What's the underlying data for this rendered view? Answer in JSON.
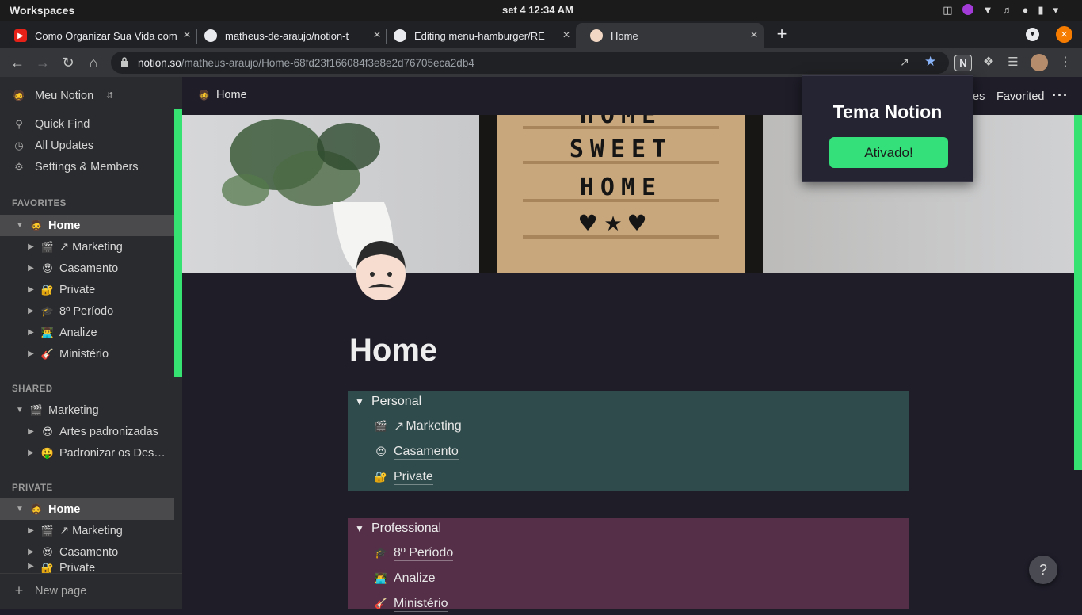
{
  "os": {
    "workspaces": "Workspaces",
    "clock": "set 4  12:34 AM"
  },
  "tabs": [
    {
      "title": "Como Organizar Sua Vida com",
      "favicon": "youtube-icon"
    },
    {
      "title": "matheus-de-araujo/notion-t",
      "favicon": "github-icon"
    },
    {
      "title": "Editing menu-hamburger/RE",
      "favicon": "github-icon"
    },
    {
      "title": "Home",
      "favicon": "notion-page-face-icon"
    }
  ],
  "address_bar": {
    "domain": "notion.so",
    "path": "/matheus-araujo/Home-68fd23f166084f3e8e2d76705eca2db4"
  },
  "sidebar": {
    "workspace": "Meu Notion",
    "menu": [
      "Quick Find",
      "All Updates",
      "Settings & Members"
    ],
    "favorites_heading": "FAVORITES",
    "favorites": [
      {
        "label": "Home",
        "emoji": "🧔"
      },
      {
        "label": "↗ Marketing",
        "emoji": "🎬"
      },
      {
        "label": "Casamento",
        "emoji": "😍"
      },
      {
        "label": "Private",
        "emoji": "🔐"
      },
      {
        "label": "8º Período",
        "emoji": "🎓"
      },
      {
        "label": "Analize",
        "emoji": "👨‍💻"
      },
      {
        "label": "Ministério",
        "emoji": "🎸"
      }
    ],
    "shared_heading": "SHARED",
    "shared": [
      {
        "label": "Marketing",
        "emoji": "🎬"
      },
      {
        "label": "Artes padronizadas",
        "emoji": "😎"
      },
      {
        "label": "Padronizar os Des…",
        "emoji": "🤑"
      }
    ],
    "private_heading": "PRIVATE",
    "private": [
      {
        "label": "Home",
        "emoji": "🧔"
      },
      {
        "label": "↗ Marketing",
        "emoji": "🎬"
      },
      {
        "label": "Casamento",
        "emoji": "😍"
      },
      {
        "label": "Private",
        "emoji": "🔐"
      }
    ],
    "new_page": "New page"
  },
  "topbar": {
    "breadcrumb": "Home",
    "updates_partial": "es",
    "favorited": "Favorited"
  },
  "cover": {
    "letterboard_lines": [
      "HOME",
      "SWEET",
      "HOME"
    ]
  },
  "page": {
    "title": "Home",
    "personal": {
      "heading": "Personal",
      "color": "#2f4b4b",
      "items": [
        {
          "label": "Marketing",
          "emoji": "🎬",
          "prefix": "↗"
        },
        {
          "label": "Casamento",
          "emoji": "😍",
          "prefix": ""
        },
        {
          "label": "Private",
          "emoji": "🔐",
          "prefix": ""
        }
      ]
    },
    "professional": {
      "heading": "Professional",
      "color": "#552e48",
      "items": [
        {
          "label": "8º Período",
          "emoji": "🎓"
        },
        {
          "label": "Analize",
          "emoji": "👨‍💻"
        },
        {
          "label": "Ministério",
          "emoji": "🎸"
        }
      ]
    }
  },
  "popup": {
    "title": "Tema Notion",
    "button": "Ativado!"
  },
  "help": "?",
  "colors": {
    "accent_green": "#35e272",
    "sidebar_bg": "#2a2b2e",
    "main_bg": "#1e1d28"
  }
}
